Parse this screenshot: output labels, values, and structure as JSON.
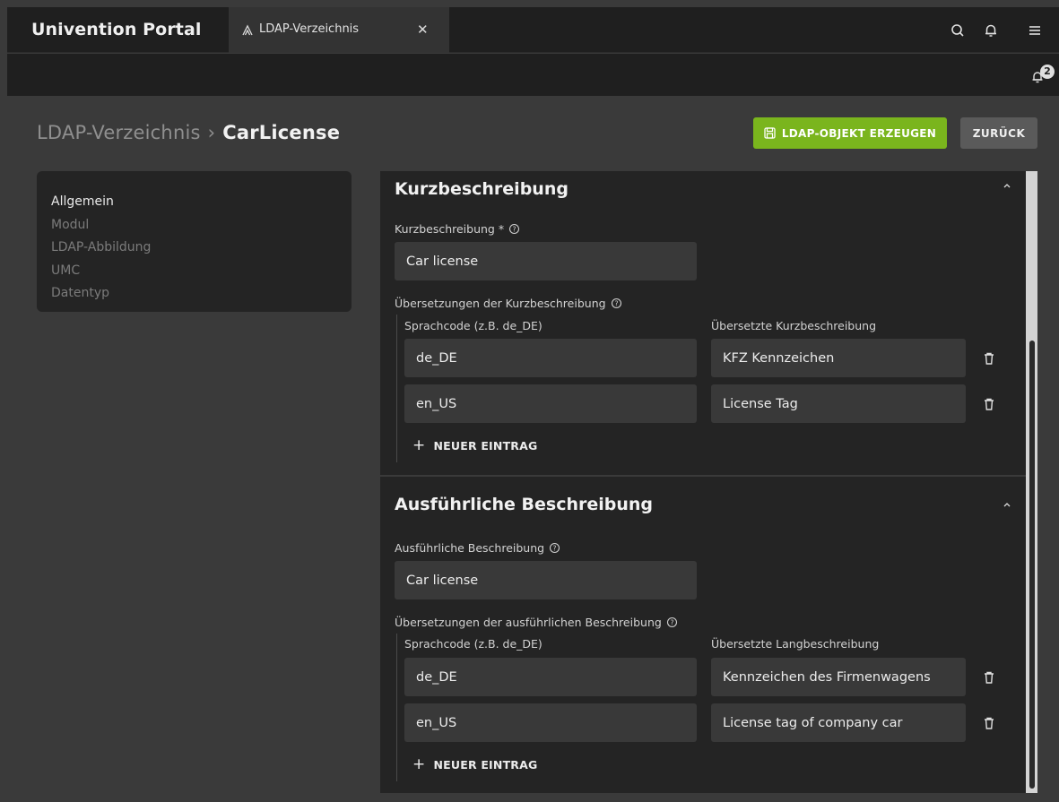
{
  "app": {
    "title": "Univention Portal",
    "tab_label": "LDAP-Verzeichnis",
    "tab_icon": "tree-icon",
    "tab_close": "✕",
    "notification_count": "2"
  },
  "breadcrumb": {
    "parent": "LDAP-Verzeichnis",
    "separator": "›",
    "current": "CarLicense"
  },
  "actions": {
    "create_label": "LDAP-OBJEKT ERZEUGEN",
    "back_label": "ZURÜCK",
    "create_color": "#7ab51d"
  },
  "sidenav": {
    "items": [
      {
        "label": "Allgemein",
        "active": true
      },
      {
        "label": "Modul",
        "active": false
      },
      {
        "label": "LDAP-Abbildung",
        "active": false
      },
      {
        "label": "UMC",
        "active": false
      },
      {
        "label": "Datentyp",
        "active": false
      }
    ]
  },
  "short_section": {
    "title": "Kurzbeschreibung",
    "field_label": "Kurzbeschreibung *",
    "field_value": "Car license",
    "translations_label": "Übersetzungen der Kurzbeschreibung",
    "col_code": "Sprachcode (z.B. de_DE)",
    "col_text": "Übersetzte Kurzbeschreibung",
    "rows": [
      {
        "code": "de_DE",
        "text": "KFZ Kennzeichen"
      },
      {
        "code": "en_US",
        "text": "License Tag"
      }
    ],
    "new_entry": "NEUER EINTRAG"
  },
  "long_section": {
    "title": "Ausführliche Beschreibung",
    "field_label": "Ausführliche Beschreibung",
    "field_value": "Car license",
    "translations_label": "Übersetzungen der ausführlichen Beschreibung",
    "col_code": "Sprachcode (z.B. de_DE)",
    "col_text": "Übersetzte Langbeschreibung",
    "rows": [
      {
        "code": "de_DE",
        "text": "Kennzeichen des Firmenwagens"
      },
      {
        "code": "en_US",
        "text": "License tag of company car"
      }
    ],
    "new_entry": "NEUER EINTRAG"
  }
}
